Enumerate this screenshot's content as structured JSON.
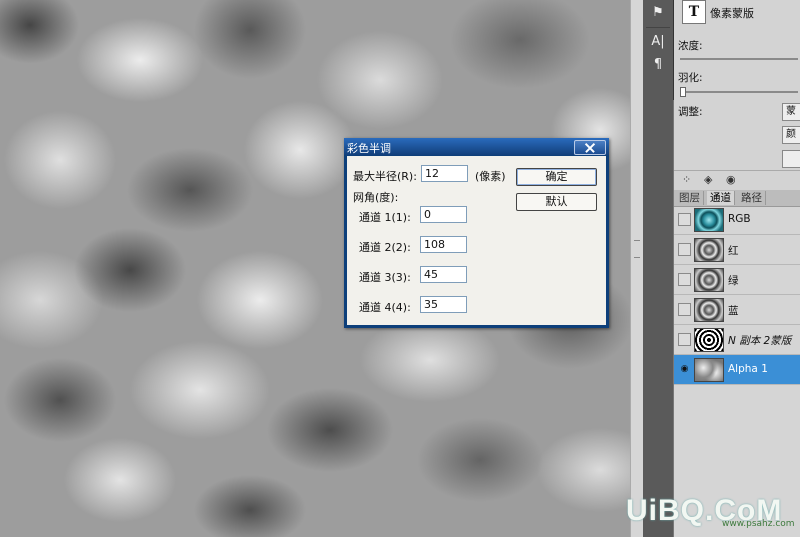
{
  "dialog": {
    "title": "彩色半调",
    "max_radius_label": "最大半径(R):",
    "max_radius_value": "12",
    "unit": "(像素)",
    "angles_label": "网角(度):",
    "channels": [
      {
        "label": "通道 1(1):",
        "value": "0"
      },
      {
        "label": "通道 2(2):",
        "value": "108"
      },
      {
        "label": "通道 3(3):",
        "value": "45"
      },
      {
        "label": "通道 4(4):",
        "value": "35"
      }
    ],
    "ok_label": "确定",
    "default_label": "默认"
  },
  "masks_panel": {
    "title": "像素蒙版",
    "type_glyph": "T",
    "density_label": "浓度:",
    "feather_label": "羽化:",
    "adjust_label": "调整:",
    "btn1": "蒙",
    "btn2": "颜",
    "btn3": ""
  },
  "layers_panel": {
    "tabs": [
      "图层",
      "通道",
      "路径"
    ],
    "active_tab": 1,
    "channels": [
      {
        "name": "RGB",
        "thumb": "rgb",
        "visible": false
      },
      {
        "name": "红",
        "thumb": "gray",
        "visible": false
      },
      {
        "name": "绿",
        "thumb": "gray",
        "visible": false
      },
      {
        "name": "蓝",
        "thumb": "gray",
        "visible": false
      },
      {
        "name": "N 副本 2蒙版",
        "thumb": "mask",
        "visible": false
      },
      {
        "name": "Alpha 1",
        "thumb": "alpha",
        "visible": true,
        "selected": true
      }
    ]
  },
  "watermark": {
    "brand": "UiBQ.CoM",
    "url": "www.psahz.com"
  },
  "colors": {
    "selection": "#3b8fd6",
    "dialog_title": "#2a6bbd"
  }
}
